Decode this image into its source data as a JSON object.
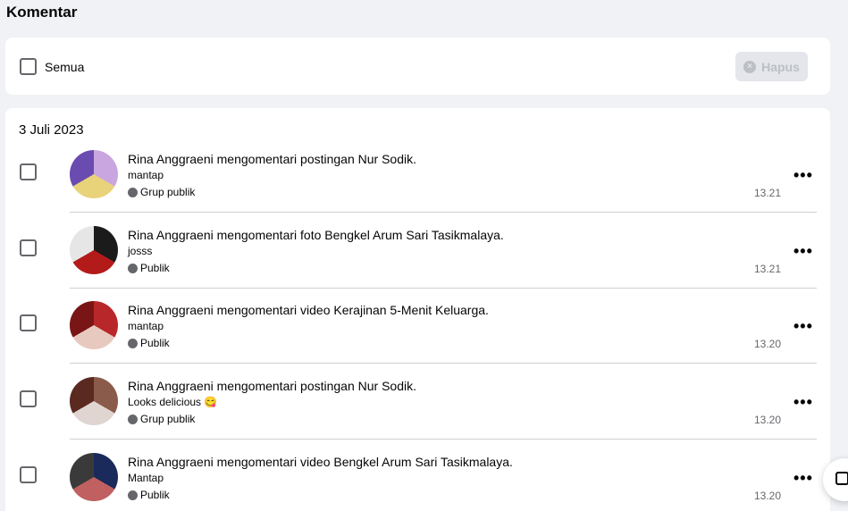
{
  "page": {
    "title": "Komentar"
  },
  "toolbar": {
    "select_all_label": "Semua",
    "delete_label": "Hapus",
    "delete_icon": "x-circle-icon"
  },
  "list": {
    "date": "3 Juli 2023",
    "items": [
      {
        "actor": "Rina Anggraeni",
        "verb": "mengomentari",
        "object_type": "postingan",
        "target": "Nur Sodik.",
        "comment": "mantap",
        "audience": "Grup publik",
        "time": "13.21",
        "avatar_colors": [
          "#c9a6e0",
          "#e8d27a",
          "#6a4bb0"
        ]
      },
      {
        "actor": "Rina Anggraeni",
        "verb": "mengomentari",
        "object_type": "foto",
        "target": "Bengkel Arum Sari Tasikmalaya.",
        "comment": "josss",
        "audience": "Publik",
        "time": "13.21",
        "avatar_colors": [
          "#1b1b1b",
          "#b31b1b",
          "#e6e6e6"
        ]
      },
      {
        "actor": "Rina Anggraeni",
        "verb": "mengomentari",
        "object_type": "video",
        "target": "Kerajinan 5-Menit Keluarga.",
        "comment": "mantap",
        "audience": "Publik",
        "time": "13.20",
        "avatar_colors": [
          "#b8282a",
          "#e7c9c0",
          "#7a1515"
        ]
      },
      {
        "actor": "Rina Anggraeni",
        "verb": "mengomentari",
        "object_type": "postingan",
        "target": "Nur Sodik.",
        "comment": "Looks delicious 😋",
        "audience": "Grup publik",
        "time": "13.20",
        "avatar_colors": [
          "#8a5a4a",
          "#e0d5d0",
          "#5a2a20"
        ]
      },
      {
        "actor": "Rina Anggraeni",
        "verb": "mengomentari",
        "object_type": "video",
        "target": "Bengkel Arum Sari Tasikmalaya.",
        "comment": "Mantap",
        "audience": "Publik",
        "time": "13.20",
        "avatar_colors": [
          "#1a2a5a",
          "#c06060",
          "#3a3a3a"
        ]
      }
    ]
  },
  "fab": {
    "icon": "compose-icon"
  }
}
